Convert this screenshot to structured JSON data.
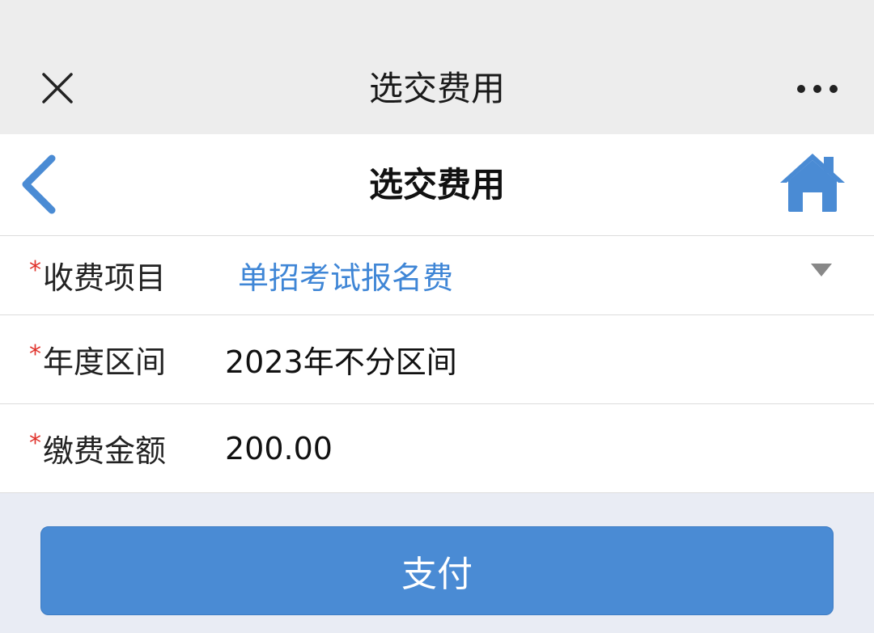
{
  "wx_bar": {
    "title": "选交费用",
    "close_icon": "close-icon",
    "more_icon": "more-dots-icon"
  },
  "header": {
    "title": "选交费用",
    "back_icon": "chevron-left-icon",
    "home_icon": "home-icon",
    "accent_color": "#4a8bd4"
  },
  "form": {
    "required_mark": "*",
    "rows": [
      {
        "label": "收费项目",
        "value": "单招考试报名费",
        "type": "select"
      },
      {
        "label": "年度区间",
        "value": "2023年不分区间",
        "type": "text"
      },
      {
        "label": "缴费金额",
        "value": "200.00",
        "type": "text"
      }
    ]
  },
  "pay_button": {
    "label": "支付"
  },
  "colors": {
    "required": "#e0322b",
    "link": "#3f86d6",
    "button": "#4a8bd4",
    "background": "#e9ecf4"
  }
}
